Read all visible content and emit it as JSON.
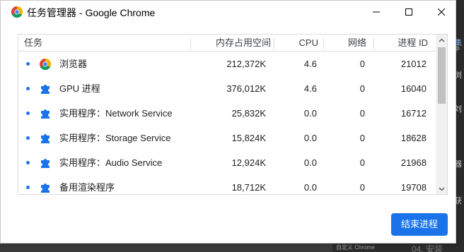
{
  "window": {
    "title": "任务管理器 - Google Chrome"
  },
  "table": {
    "headers": {
      "task": "任务",
      "memory": "内存占用空间",
      "cpu": "CPU",
      "network": "网络",
      "pid": "进程 ID"
    },
    "rows": [
      {
        "name": "浏览器",
        "icon": "chrome-icon",
        "memory": "212,372K",
        "cpu": "4.6",
        "network": "0",
        "pid": "21012"
      },
      {
        "name": "GPU 进程",
        "icon": "puzzle-icon",
        "memory": "376,012K",
        "cpu": "4.6",
        "network": "0",
        "pid": "16040"
      },
      {
        "name": "实用程序：Network Service",
        "icon": "puzzle-icon",
        "memory": "25,832K",
        "cpu": "0.0",
        "network": "0",
        "pid": "16712"
      },
      {
        "name": "实用程序：Storage Service",
        "icon": "puzzle-icon",
        "memory": "15,824K",
        "cpu": "0.0",
        "network": "0",
        "pid": "18628"
      },
      {
        "name": "实用程序：Audio Service",
        "icon": "puzzle-icon",
        "memory": "12,924K",
        "cpu": "0.0",
        "network": "0",
        "pid": "21968"
      },
      {
        "name": "备用渲染程序",
        "icon": "puzzle-icon",
        "memory": "18,712K",
        "cpu": "0.0",
        "network": "0",
        "pid": "19708"
      }
    ]
  },
  "actions": {
    "end_process_label": "结束进程"
  },
  "background": {
    "side_chars": [
      "集",
      "中",
      "浏",
      "刘",
      "器",
      "获"
    ],
    "bottom_link": "自定义 Chrome",
    "bottom_heading": "04. 安装"
  },
  "colors": {
    "accent": "#1a73e8",
    "window_bg": "#ffffff",
    "border": "#dadce0"
  }
}
